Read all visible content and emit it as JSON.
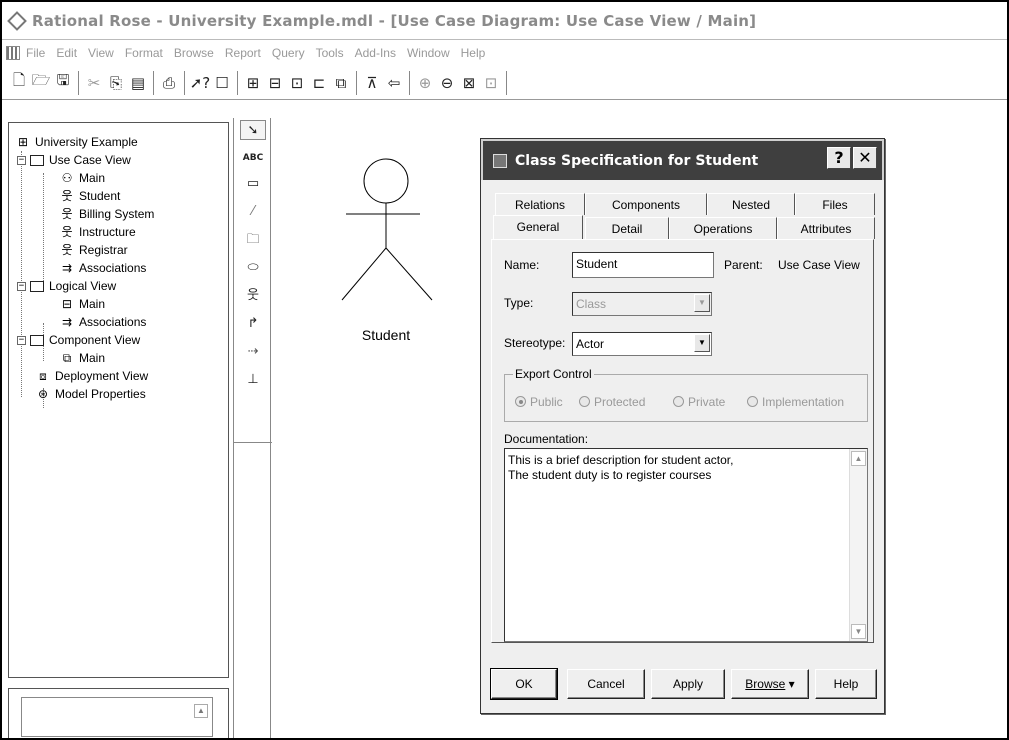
{
  "window": {
    "title": "Rational Rose - University Example.mdl - [Use Case Diagram: Use Case View / Main]"
  },
  "menu": [
    "File",
    "Edit",
    "View",
    "Format",
    "Browse",
    "Report",
    "Query",
    "Tools",
    "Add-Ins",
    "Window",
    "Help"
  ],
  "toolbar_icons": [
    "new-file-icon",
    "open-file-icon",
    "save-icon",
    "cut-icon",
    "copy-icon",
    "paste-icon",
    "print-icon",
    "context-help-icon",
    "view-documentation-icon",
    "browse-class-diagram-icon",
    "browse-interaction-diagram-icon",
    "browse-component-diagram-icon",
    "browse-state-diagram-icon",
    "browse-deployment-diagram-icon",
    "browse-parent-icon",
    "browse-previous-icon",
    "zoom-in-icon",
    "zoom-out-icon",
    "fit-in-window-icon",
    "undo-fit-icon"
  ],
  "tree": {
    "root": "University Example",
    "use_case_view": "Use Case View",
    "ucv_main": "Main",
    "student": "Student",
    "billing": "Billing System",
    "instructure": "Instructure",
    "registrar": "Registrar",
    "ucv_assoc": "Associations",
    "logical_view": "Logical View",
    "lv_main": "Main",
    "lv_assoc": "Associations",
    "component_view": "Component View",
    "cv_main": "Main",
    "deployment_view": "Deployment View",
    "model_properties": "Model Properties"
  },
  "palette": {
    "text_box": "ABC"
  },
  "diagram": {
    "actor_label": "Student"
  },
  "dialog": {
    "title": "Class Specification for Student",
    "help_btn": "?",
    "close_btn": "✕",
    "tabs_back": [
      "Relations",
      "Components",
      "Nested",
      "Files"
    ],
    "tabs_front": [
      "General",
      "Detail",
      "Operations",
      "Attributes"
    ],
    "name_label": "Name:",
    "name_value": "Student",
    "parent_label": "Parent:",
    "parent_value": "Use Case View",
    "type_label": "Type:",
    "type_value": "Class",
    "stereotype_label": "Stereotype:",
    "stereotype_value": "Actor",
    "export_control": "Export Control",
    "radios": [
      "Public",
      "Protected",
      "Private",
      "Implementation"
    ],
    "documentation_label": "Documentation:",
    "documentation_lines": [
      "This is a brief description for student actor,",
      "The student duty is to register courses"
    ],
    "buttons": {
      "ok": "OK",
      "cancel": "Cancel",
      "apply": "Apply",
      "browse": "Browse",
      "help": "Help"
    }
  }
}
